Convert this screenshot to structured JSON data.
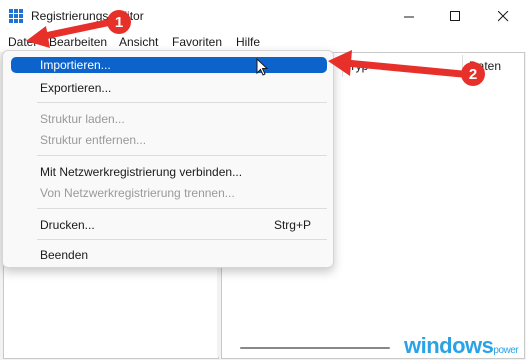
{
  "window": {
    "title": "Registrierungs-Editor"
  },
  "menubar": {
    "items": [
      {
        "label": "Datei"
      },
      {
        "label": "Bearbeiten"
      },
      {
        "label": "Ansicht"
      },
      {
        "label": "Favoriten"
      },
      {
        "label": "Hilfe"
      }
    ]
  },
  "list_headers": {
    "type": "Typ",
    "data": "Daten"
  },
  "file_menu": {
    "import": "Importieren...",
    "export": "Exportieren...",
    "load_hive": "Struktur laden...",
    "unload_hive": "Struktur entfernen...",
    "connect": "Mit Netzwerkregistrierung verbinden...",
    "disconnect": "Von Netzwerkregistrierung trennen...",
    "print": "Drucken...",
    "print_shortcut": "Strg+P",
    "exit": "Beenden"
  },
  "annotations": {
    "step1": "1",
    "step2": "2",
    "accent_color": "#e8302a"
  },
  "watermark": {
    "brand": "windows",
    "suffix": "power"
  },
  "colors": {
    "highlight": "#0d63cc",
    "icon_blue": "#1e73d2"
  }
}
